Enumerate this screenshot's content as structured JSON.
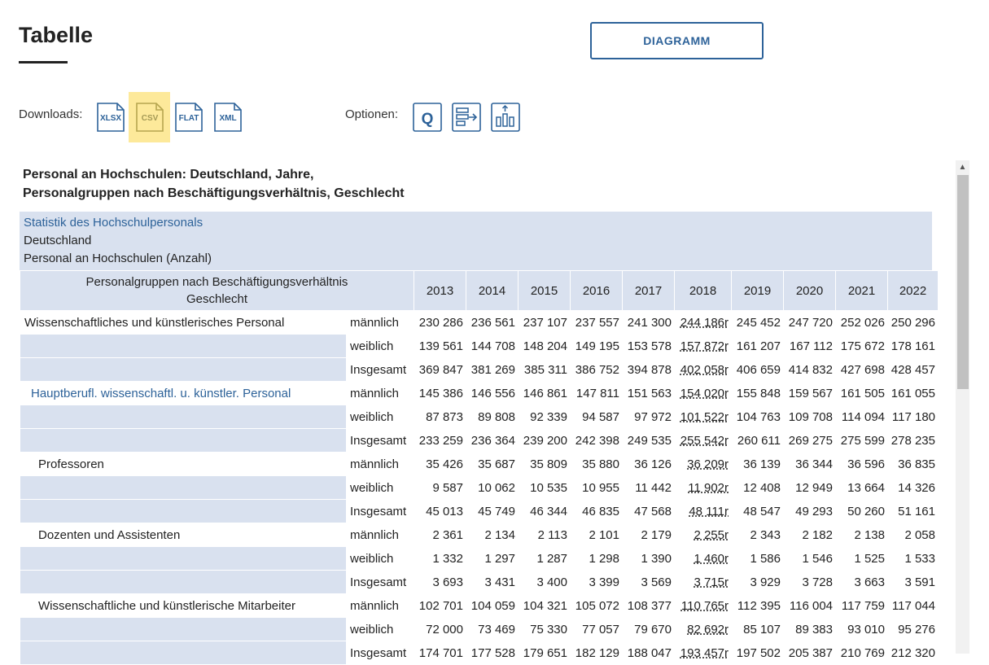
{
  "page_title": "Tabelle",
  "diagram_button": "DIAGRAMM",
  "downloads": {
    "label": "Downloads:",
    "formats": [
      "XLSX",
      "CSV",
      "FLAT",
      "XML"
    ]
  },
  "options": {
    "label": "Optionen:",
    "q_label": "Q"
  },
  "table": {
    "title_line1": "Personal an Hochschulen: Deutschland, Jahre,",
    "title_line2": "Personalgruppen nach Beschäftigungsverhältnis, Geschlecht",
    "meta_source": "Statistik des Hochschulpersonals",
    "meta_region": "Deutschland",
    "meta_measure": "Personal an Hochschulen (Anzahl)",
    "header_line1": "Personalgruppen nach Beschäftigungsverhältnis",
    "header_line2": "Geschlecht",
    "years": [
      "2013",
      "2014",
      "2015",
      "2016",
      "2017",
      "2018",
      "2019",
      "2020",
      "2021",
      "2022"
    ],
    "rows": [
      {
        "group": "Wissenschaftliches und künstlerisches Personal",
        "gender": "männlich",
        "values": [
          "230 286",
          "236 561",
          "237 107",
          "237 557",
          "241 300",
          "244 186r",
          "245 452",
          "247 720",
          "252 026",
          "250 296"
        ]
      },
      {
        "group": "",
        "gender": "weiblich",
        "values": [
          "139 561",
          "144 708",
          "148 204",
          "149 195",
          "153 578",
          "157 872r",
          "161 207",
          "167 112",
          "175 672",
          "178 161"
        ]
      },
      {
        "group": "",
        "gender": "Insgesamt",
        "values": [
          "369 847",
          "381 269",
          "385 311",
          "386 752",
          "394 878",
          "402 058r",
          "406 659",
          "414 832",
          "427 698",
          "428 457"
        ]
      },
      {
        "group": "Hauptberufl. wissenschaftl. u. künstler. Personal",
        "gender": "männlich",
        "values": [
          "145 386",
          "146 556",
          "146 861",
          "147 811",
          "151 563",
          "154 020r",
          "155 848",
          "159 567",
          "161 505",
          "161 055"
        ]
      },
      {
        "group": "",
        "gender": "weiblich",
        "values": [
          "87 873",
          "89 808",
          "92 339",
          "94 587",
          "97 972",
          "101 522r",
          "104 763",
          "109 708",
          "114 094",
          "117 180"
        ]
      },
      {
        "group": "",
        "gender": "Insgesamt",
        "values": [
          "233 259",
          "236 364",
          "239 200",
          "242 398",
          "249 535",
          "255 542r",
          "260 611",
          "269 275",
          "275 599",
          "278 235"
        ]
      },
      {
        "group": "Professoren",
        "gender": "männlich",
        "values": [
          "35 426",
          "35 687",
          "35 809",
          "35 880",
          "36 126",
          "36 209r",
          "36 139",
          "36 344",
          "36 596",
          "36 835"
        ]
      },
      {
        "group": "",
        "gender": "weiblich",
        "values": [
          "9 587",
          "10 062",
          "10 535",
          "10 955",
          "11 442",
          "11 902r",
          "12 408",
          "12 949",
          "13 664",
          "14 326"
        ]
      },
      {
        "group": "",
        "gender": "Insgesamt",
        "values": [
          "45 013",
          "45 749",
          "46 344",
          "46 835",
          "47 568",
          "48 111r",
          "48 547",
          "49 293",
          "50 260",
          "51 161"
        ]
      },
      {
        "group": "Dozenten und Assistenten",
        "gender": "männlich",
        "values": [
          "2 361",
          "2 134",
          "2 113",
          "2 101",
          "2 179",
          "2 255r",
          "2 343",
          "2 182",
          "2 138",
          "2 058"
        ]
      },
      {
        "group": "",
        "gender": "weiblich",
        "values": [
          "1 332",
          "1 297",
          "1 287",
          "1 298",
          "1 390",
          "1 460r",
          "1 586",
          "1 546",
          "1 525",
          "1 533"
        ]
      },
      {
        "group": "",
        "gender": "Insgesamt",
        "values": [
          "3 693",
          "3 431",
          "3 400",
          "3 399",
          "3 569",
          "3 715r",
          "3 929",
          "3 728",
          "3 663",
          "3 591"
        ]
      },
      {
        "group": "Wissenschaftliche und künstlerische Mitarbeiter",
        "gender": "männlich",
        "values": [
          "102 701",
          "104 059",
          "104 321",
          "105 072",
          "108 377",
          "110 765r",
          "112 395",
          "116 004",
          "117 759",
          "117 044"
        ]
      },
      {
        "group": "",
        "gender": "weiblich",
        "values": [
          "72 000",
          "73 469",
          "75 330",
          "77 057",
          "79 670",
          "82 692r",
          "85 107",
          "89 383",
          "93 010",
          "95 276"
        ]
      },
      {
        "group": "",
        "gender": "Insgesamt",
        "values": [
          "174 701",
          "177 528",
          "179 651",
          "182 129",
          "188 047",
          "193 457r",
          "197 502",
          "205 387",
          "210 769",
          "212 320"
        ]
      }
    ]
  }
}
